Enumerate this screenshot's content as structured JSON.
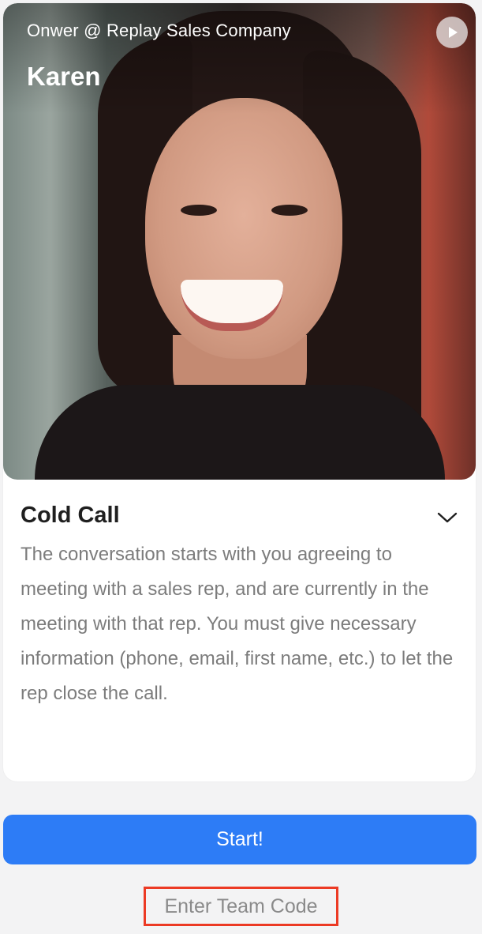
{
  "persona": {
    "subtitle": "Onwer @ Replay Sales Company",
    "name": "Karen",
    "play_icon": "play-circle-icon"
  },
  "scenario": {
    "title": "Cold Call",
    "expand_icon": "chevron-down-icon",
    "description": "The conversation starts with you agreeing to meeting with a sales rep, and are currently in the meeting with that rep. You must give necessary information (phone, email, first name, etc.) to let the rep close the call."
  },
  "actions": {
    "start_label": "Start!",
    "team_code_label": "Enter Team Code"
  },
  "colors": {
    "accent": "#2d7cf6",
    "highlight_border": "#ec3a24",
    "page_background": "#f3f3f4"
  }
}
